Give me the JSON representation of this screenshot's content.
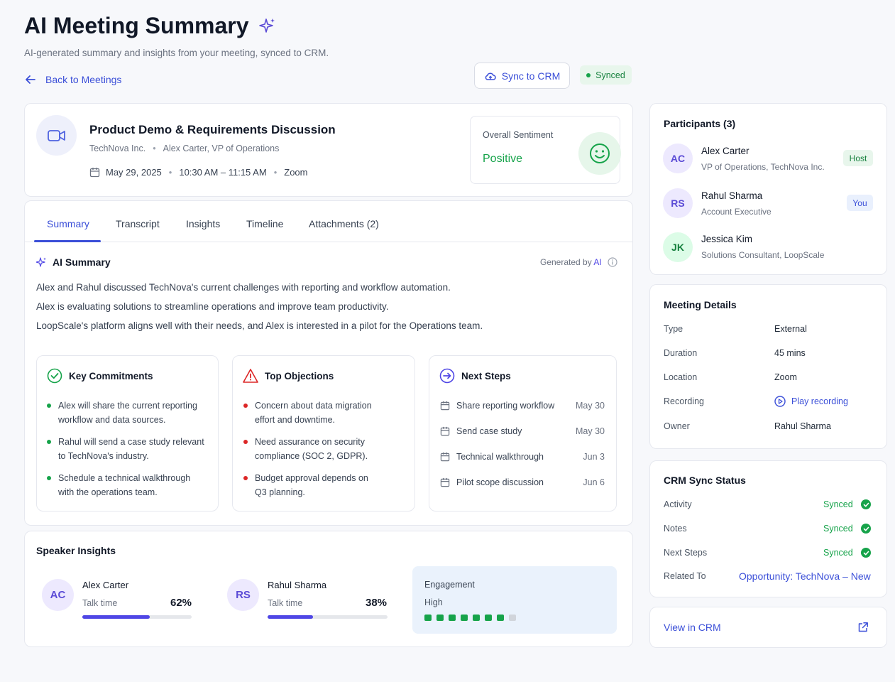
{
  "header": {
    "title": "AI Meeting Summary",
    "subtitle": "AI-generated summary and insights from your meeting, synced to CRM.",
    "back_label": "Back to Meetings",
    "sync_button_label": "Sync to CRM",
    "sync_status": "Synced"
  },
  "meeting": {
    "title": "Product Demo & Requirements Discussion",
    "company": "TechNova Inc.",
    "contact": "Alex Carter, VP of Operations",
    "date": "May 29, 2025",
    "time": "10:30 AM – 11:15 AM",
    "platform": "Zoom",
    "sentiment_label": "Overall Sentiment",
    "sentiment_value": "Positive"
  },
  "tabs": [
    "Summary",
    "Transcript",
    "Insights",
    "Timeline",
    "Attachments (2)"
  ],
  "summary": {
    "heading": "AI Summary",
    "generated_by": "Generated by AI",
    "lines": [
      "Alex and Rahul discussed TechNova's current challenges with reporting and workflow automation.",
      "Alex is evaluating solutions to streamline operations and improve team productivity.",
      "LoopScale's platform aligns well with their needs, and Alex is interested in a pilot for the Operations team."
    ]
  },
  "commitments": {
    "heading": "Key Commitments",
    "items": [
      [
        "Alex will share the current reporting",
        "workflow and data sources."
      ],
      [
        "Rahul will send a case study relevant",
        "to TechNova's industry."
      ],
      [
        "Schedule a technical walkthrough",
        "with the operations team."
      ]
    ]
  },
  "objections": {
    "heading": "Top Objections",
    "items": [
      [
        "Concern about data migration",
        "effort and downtime."
      ],
      [
        "Need assurance on security",
        "compliance (SOC 2, GDPR)."
      ],
      [
        "Budget approval depends on",
        "Q3 planning."
      ]
    ]
  },
  "next_steps": {
    "heading": "Next Steps",
    "items": [
      {
        "label": "Share reporting workflow",
        "date": "May 30"
      },
      {
        "label": "Send case study",
        "date": "May 30"
      },
      {
        "label": "Technical walkthrough",
        "date": "Jun 3"
      },
      {
        "label": "Pilot scope discussion",
        "date": "Jun 6"
      }
    ]
  },
  "speaker_insights": {
    "heading": "Speaker Insights",
    "speakers": [
      {
        "initials": "AC",
        "name": "Alex Carter",
        "metric": "Talk time",
        "percent": "62%",
        "fraction": 0.62
      },
      {
        "initials": "RS",
        "name": "Rahul Sharma",
        "metric": "Talk time",
        "percent": "38%",
        "fraction": 0.38
      }
    ],
    "engagement_label": "Engagement",
    "engagement_value": "High",
    "engagement_level": 7,
    "engagement_max": 8
  },
  "participants": {
    "heading": "Participants (3)",
    "people": [
      {
        "initials": "AC",
        "name": "Alex Carter",
        "role": "VP of Operations, TechNova Inc.",
        "badge": "Host"
      },
      {
        "initials": "RS",
        "name": "Rahul Sharma",
        "role": "Account Executive",
        "badge": "You"
      },
      {
        "initials": "JK",
        "name": "Jessica Kim",
        "role": "Solutions Consultant, LoopScale",
        "badge": ""
      }
    ]
  },
  "details": {
    "heading": "Meeting Details",
    "type_label": "Type",
    "type_value": "External",
    "duration_label": "Duration",
    "duration_value": "45 mins",
    "location_label": "Location",
    "location_value": "Zoom",
    "recording_label": "Recording",
    "recording_value": "Play recording",
    "owner_label": "Owner",
    "owner_value": "Rahul Sharma"
  },
  "crm": {
    "heading": "CRM Sync Status",
    "rows": [
      {
        "label": "Activity",
        "status": "Synced"
      },
      {
        "label": "Notes",
        "status": "Synced"
      },
      {
        "label": "Next Steps",
        "status": "Synced"
      }
    ],
    "related_label": "Related To",
    "related_value": "Opportunity: TechNova – New",
    "view_label": "View in CRM"
  },
  "colors": {
    "accent": "#4f46e5",
    "success": "#16a34a",
    "danger": "#dc2626"
  }
}
